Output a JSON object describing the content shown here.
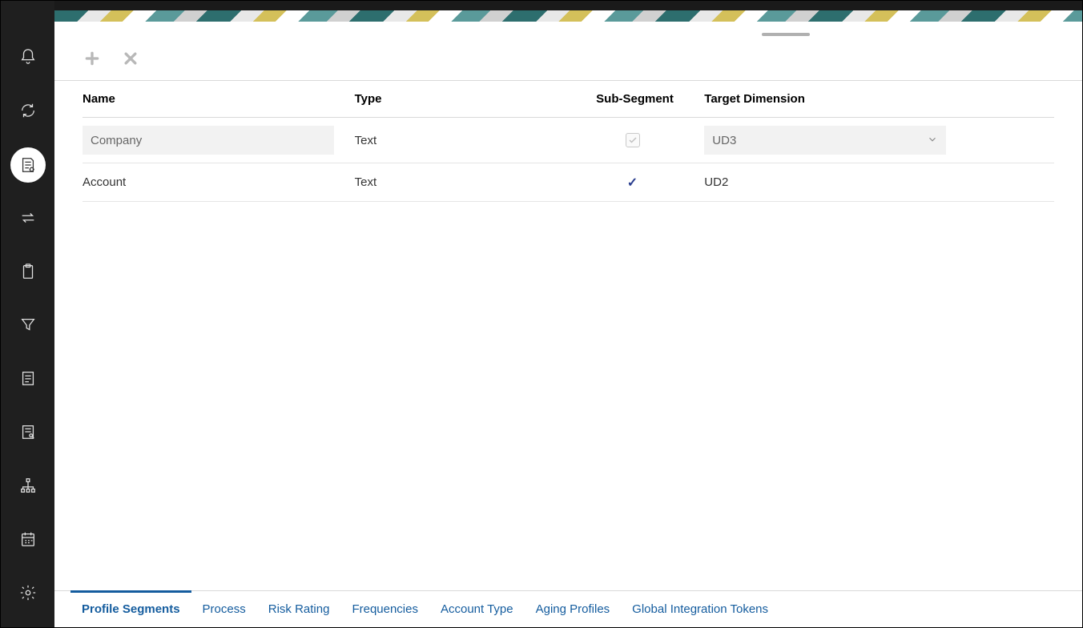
{
  "sidebar": {
    "icons": [
      "bell-icon",
      "refresh-icon",
      "report-config-icon",
      "transfer-icon",
      "clipboard-icon",
      "filter-icon",
      "document-icon",
      "review-icon",
      "hierarchy-icon",
      "calendar-icon",
      "settings-icon"
    ],
    "active_index": 2
  },
  "toolbar": {
    "add_label": "Add",
    "delete_label": "Delete"
  },
  "table": {
    "headers": {
      "name": "Name",
      "type": "Type",
      "sub_segment": "Sub-Segment",
      "target_dimension": "Target Dimension"
    },
    "rows": [
      {
        "name": "Company",
        "type": "Text",
        "sub_segment": true,
        "sub_segment_disabled": true,
        "target_dimension": "UD3",
        "editable": true
      },
      {
        "name": "Account",
        "type": "Text",
        "sub_segment": true,
        "sub_segment_disabled": false,
        "target_dimension": "UD2",
        "editable": false
      }
    ]
  },
  "tabs": [
    "Profile Segments",
    "Process",
    "Risk Rating",
    "Frequencies",
    "Account Type",
    "Aging Profiles",
    "Global Integration Tokens"
  ],
  "active_tab_index": 0
}
